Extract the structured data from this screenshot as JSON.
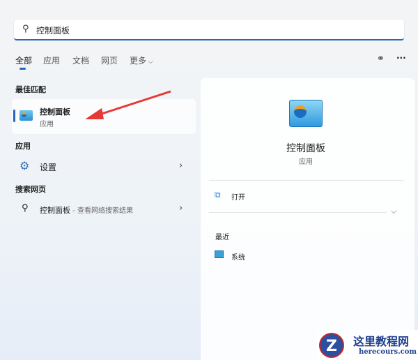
{
  "search": {
    "value": "控制面板",
    "icon": "search-icon"
  },
  "tabs": [
    {
      "label": "全部",
      "active": true
    },
    {
      "label": "应用"
    },
    {
      "label": "文档"
    },
    {
      "label": "网页"
    },
    {
      "label": "更多"
    }
  ],
  "toolbar": {
    "share_icon": "people-icon",
    "more_label": "···"
  },
  "best_match": {
    "heading": "最佳匹配",
    "title": "控制面板",
    "subtitle": "应用"
  },
  "apps": {
    "heading": "应用",
    "items": [
      {
        "label": "设置",
        "icon": "gear-icon"
      }
    ]
  },
  "web": {
    "heading": "搜索网页",
    "query": "控制面板",
    "suffix": " - 查看网络搜索结果"
  },
  "detail": {
    "title": "控制面板",
    "subtitle": "应用",
    "open_label": "打开",
    "recent_heading": "最近",
    "recent_items": [
      {
        "label": "系统"
      }
    ]
  },
  "watermark": {
    "name": "这里教程网",
    "url": "herecours.com"
  },
  "colors": {
    "accent": "#2566c0",
    "arrow": "#e53935"
  }
}
